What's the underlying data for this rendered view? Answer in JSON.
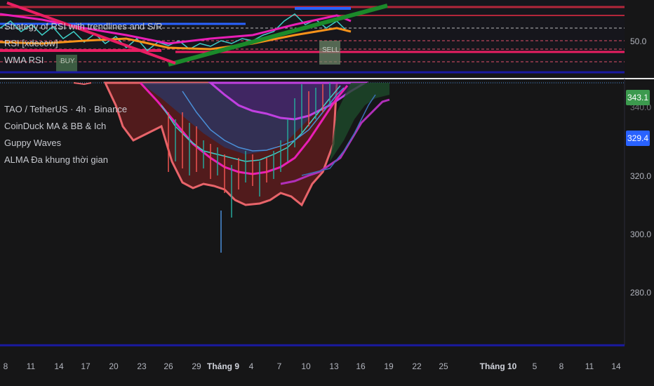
{
  "panes": {
    "rsi_pane": {
      "indicators": [
        "Strategy of RSI with trendlines and S/R",
        "RSI [xdecow]",
        "WMA RSI"
      ],
      "axis_label": "50.0",
      "markers": [
        "BUY",
        "SELL"
      ]
    },
    "price_pane": {
      "indicators": [
        "TAO / TetherUS · 4h · Binance",
        "CoinDuck MA & BB & Ich",
        "Guppy Waves",
        "ALMA Đa khung thời gian"
      ],
      "partial_label": "340.0",
      "price_tags": [
        {
          "value": "343.1",
          "color": "#3c9a4e"
        },
        {
          "value": "329.4",
          "color": "#2962ff"
        }
      ]
    }
  },
  "chart_data": {
    "type": "line",
    "title": "TAO / TetherUS · 4h · Binance",
    "price_axis_ticks": [
      320.0,
      300.0,
      280.0
    ],
    "ylim": [
      262,
      352
    ],
    "last_price": 343.1,
    "alma_value": 329.4,
    "x_tick_labels": [
      "8",
      "11",
      "14",
      "17",
      "20",
      "23",
      "26",
      "29",
      "Tháng 9",
      "4",
      "7",
      "10",
      "13",
      "16",
      "19",
      "22",
      "25",
      "Tháng 10",
      "5",
      "8",
      "11",
      "14"
    ],
    "month_labels": [
      "Tháng 9",
      "Tháng 10"
    ],
    "grid": false
  },
  "colors": {
    "background": "#161617",
    "up": "#26a69a",
    "down": "#ef5350",
    "magenta": "#e91eb6",
    "green_trend": "#1b8a2a",
    "orange": "#f7931a",
    "navy_border": "#1a1aa0"
  }
}
